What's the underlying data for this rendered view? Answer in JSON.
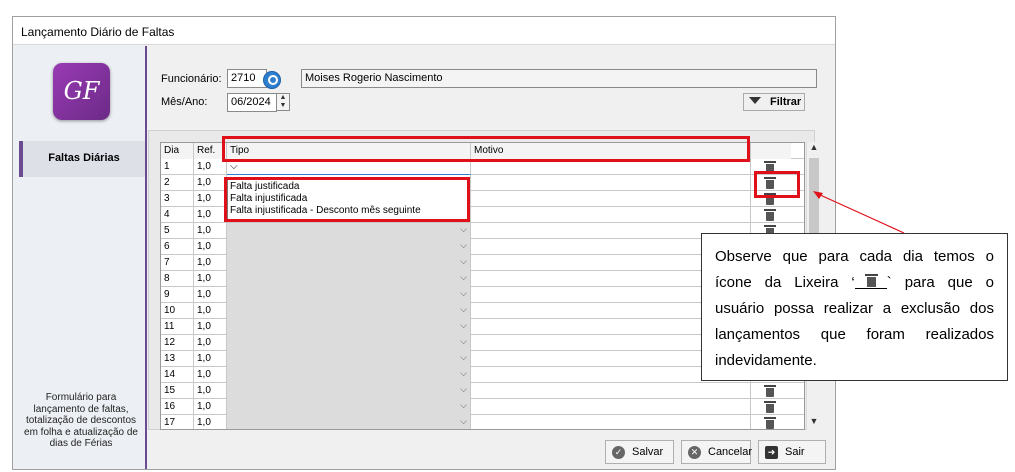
{
  "window": {
    "title": "Lançamento Diário de Faltas"
  },
  "sidebar": {
    "logo_text": "GF",
    "item_label": "Faltas Diárias",
    "description": "Formulário para lançamento de faltas, totalização de descontos em folha e atualização de dias de Férias"
  },
  "form": {
    "funcionario_label": "Funcionário:",
    "funcionario_code": "2710",
    "funcionario_name": "Moises Rogerio Nascimento",
    "mesano_label": "Mês/Ano:",
    "mesano_value": "06/2024",
    "filter_label": "Filtrar"
  },
  "grid": {
    "headers": {
      "dia": "Dia",
      "ref": "Ref.",
      "tipo": "Tipo",
      "motivo": "Motivo"
    },
    "rows": [
      {
        "dia": "1",
        "ref": "1,0"
      },
      {
        "dia": "2",
        "ref": "1,0"
      },
      {
        "dia": "3",
        "ref": "1,0"
      },
      {
        "dia": "4",
        "ref": "1,0"
      },
      {
        "dia": "5",
        "ref": "1,0"
      },
      {
        "dia": "6",
        "ref": "1,0"
      },
      {
        "dia": "7",
        "ref": "1,0"
      },
      {
        "dia": "8",
        "ref": "1,0"
      },
      {
        "dia": "9",
        "ref": "1,0"
      },
      {
        "dia": "10",
        "ref": "1,0"
      },
      {
        "dia": "11",
        "ref": "1,0"
      },
      {
        "dia": "12",
        "ref": "1,0"
      },
      {
        "dia": "13",
        "ref": "1,0"
      },
      {
        "dia": "14",
        "ref": "1,0"
      },
      {
        "dia": "15",
        "ref": "1,0"
      },
      {
        "dia": "16",
        "ref": "1,0"
      },
      {
        "dia": "17",
        "ref": "1,0"
      }
    ],
    "dropdown_options": [
      "Falta justificada",
      "Falta injustificada",
      "Falta injustificada - Desconto mês seguinte"
    ]
  },
  "footer": {
    "save_label": "Salvar",
    "cancel_label": "Cancelar",
    "exit_label": "Sair"
  },
  "callout": {
    "text_before": "Observe que para cada dia temos o ícone da Lixeira ‘",
    "text_after": "` para que o usuário possa realizar a exclusão dos lançamentos que foram realizados indevidamente."
  },
  "icons": {
    "search": "search-icon",
    "filter": "filter-icon",
    "trash": "trash-icon",
    "save": "check-circle-icon",
    "cancel": "close-circle-icon",
    "exit": "exit-icon"
  },
  "colors": {
    "annotation_red": "#e0101a",
    "accent_purple": "#6a4b8f",
    "search_blue": "#2f7fd0"
  }
}
